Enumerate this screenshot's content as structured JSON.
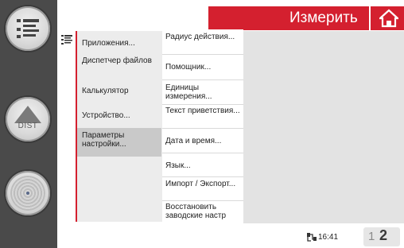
{
  "header": {
    "title": "Измерить",
    "home_icon": "home-icon"
  },
  "sidebar": {
    "buttons": [
      {
        "icon": "menu-list-icon"
      },
      {
        "icon": "dist-icon",
        "label": "DIST"
      },
      {
        "icon": "target-icon"
      }
    ]
  },
  "menu": {
    "icon": "list-icon",
    "items": [
      {
        "label": "Приложения..."
      },
      {
        "label": "Диспетчер файлов"
      },
      {
        "label": "Калькулятор"
      },
      {
        "label": "Устройство..."
      },
      {
        "label": "Параметры настройки..."
      }
    ],
    "selected_index": 4
  },
  "submenu": {
    "items": [
      {
        "label": "Радиус действия..."
      },
      {
        "label": "Помощник..."
      },
      {
        "label": "Единицы измерения..."
      },
      {
        "label": "Текст приветствия..."
      },
      {
        "label": "Дата и время..."
      },
      {
        "label": "Язык..."
      },
      {
        "label": "Импорт / Экспорт..."
      },
      {
        "label": "Восстановить заводские настр"
      }
    ]
  },
  "status": {
    "time": "16:41",
    "connection_icon": "connection-icon",
    "page_current": "1",
    "page_total": "2"
  },
  "colors": {
    "accent": "#d4202f",
    "sidebar": "#4a4a4a",
    "list_bg": "#ececec",
    "selected_bg": "#c9c9c9",
    "content_bg": "#e3e3e3"
  }
}
